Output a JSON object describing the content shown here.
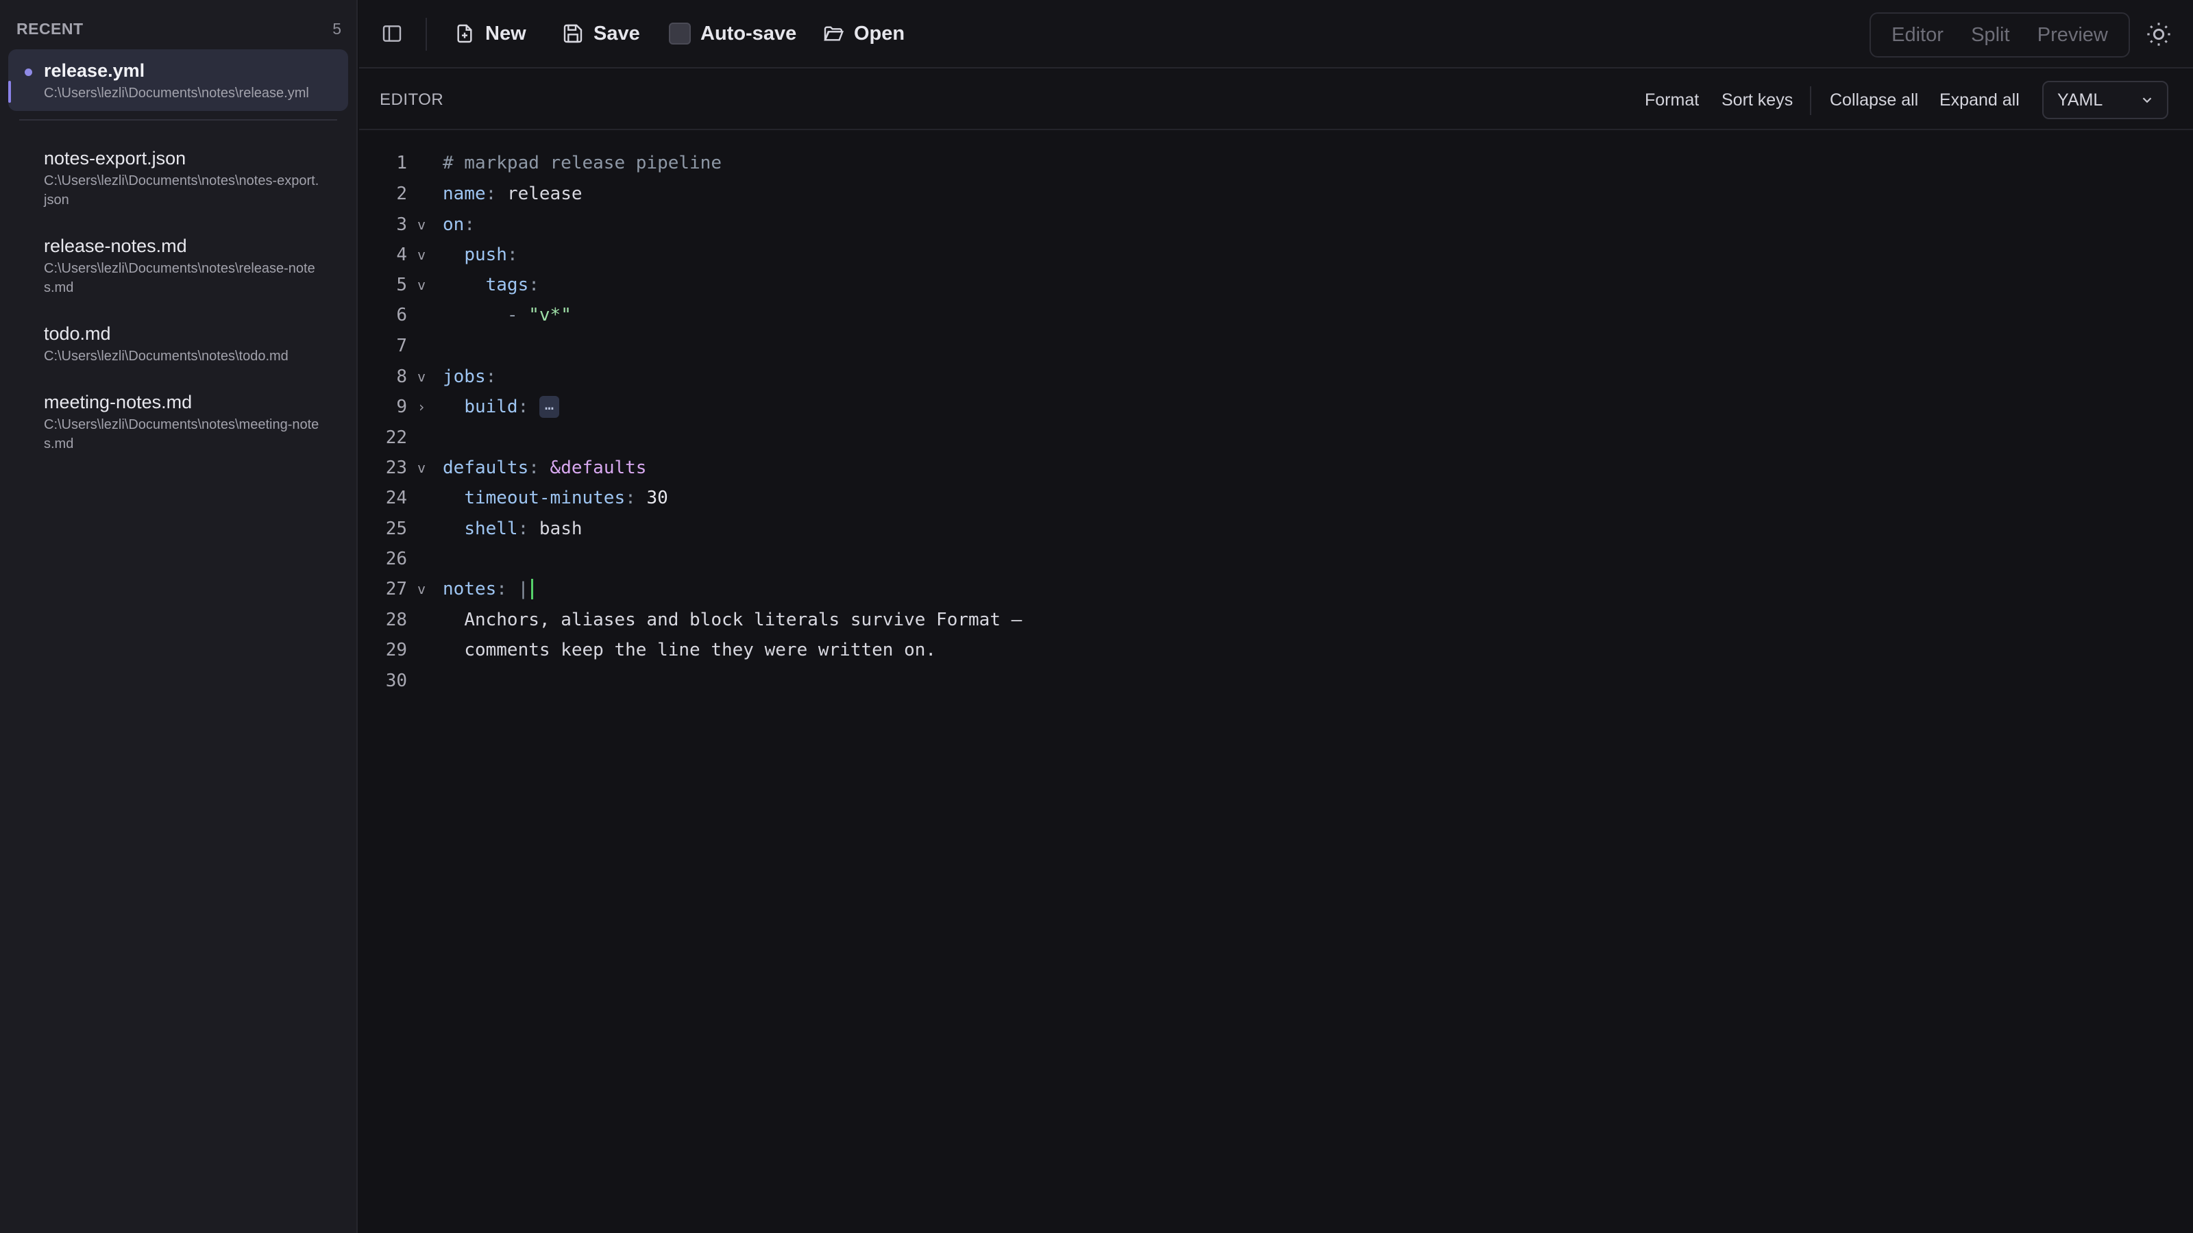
{
  "sidebar": {
    "title": "RECENT",
    "count": "5",
    "files": [
      {
        "name": "release.yml",
        "path": "C:\\Users\\lezli\\Documents\\notes\\release.yml",
        "active": true
      },
      {
        "name": "notes-export.json",
        "path": "C:\\Users\\lezli\\Documents\\notes\\notes-export.json"
      },
      {
        "name": "release-notes.md",
        "path": "C:\\Users\\lezli\\Documents\\notes\\release-notes.md"
      },
      {
        "name": "todo.md",
        "path": "C:\\Users\\lezli\\Documents\\notes\\todo.md"
      },
      {
        "name": "meeting-notes.md",
        "path": "C:\\Users\\lezli\\Documents\\notes\\meeting-notes.md"
      }
    ]
  },
  "toolbar": {
    "new_label": "New",
    "save_label": "Save",
    "autosave_label": "Auto-save",
    "open_label": "Open",
    "views": [
      "Editor",
      "Split",
      "Preview"
    ]
  },
  "editorbar": {
    "label": "EDITOR",
    "format": "Format",
    "sort_keys": "Sort keys",
    "collapse_all": "Collapse all",
    "expand_all": "Expand all",
    "language": "YAML"
  },
  "code": {
    "lines": [
      {
        "n": "1",
        "fold": "",
        "text": "# markpad release pipeline"
      },
      {
        "n": "2",
        "fold": "",
        "key": "name",
        "value": "release"
      },
      {
        "n": "3",
        "fold": "v",
        "key": "on"
      },
      {
        "n": "4",
        "fold": "v",
        "key": "push"
      },
      {
        "n": "5",
        "fold": "v",
        "key": "tags"
      },
      {
        "n": "6",
        "fold": "",
        "item": "\"v*\""
      },
      {
        "n": "7",
        "fold": ""
      },
      {
        "n": "8",
        "fold": "v",
        "key": "jobs"
      },
      {
        "n": "9",
        "fold": "›",
        "key": "build",
        "collapsed": "…"
      },
      {
        "n": "22",
        "fold": ""
      },
      {
        "n": "23",
        "fold": "v",
        "key": "defaults",
        "anchor": "&defaults"
      },
      {
        "n": "24",
        "fold": "",
        "key": "timeout-minutes",
        "value": "30"
      },
      {
        "n": "25",
        "fold": "",
        "key": "shell",
        "value": "bash"
      },
      {
        "n": "26",
        "fold": ""
      },
      {
        "n": "27",
        "fold": "v",
        "key": "notes",
        "literal": "|"
      },
      {
        "n": "28",
        "fold": "",
        "text": "Anchors, aliases and block literals survive Format —"
      },
      {
        "n": "29",
        "fold": "",
        "text": "comments keep the line they were written on."
      },
      {
        "n": "30",
        "fold": ""
      }
    ]
  }
}
